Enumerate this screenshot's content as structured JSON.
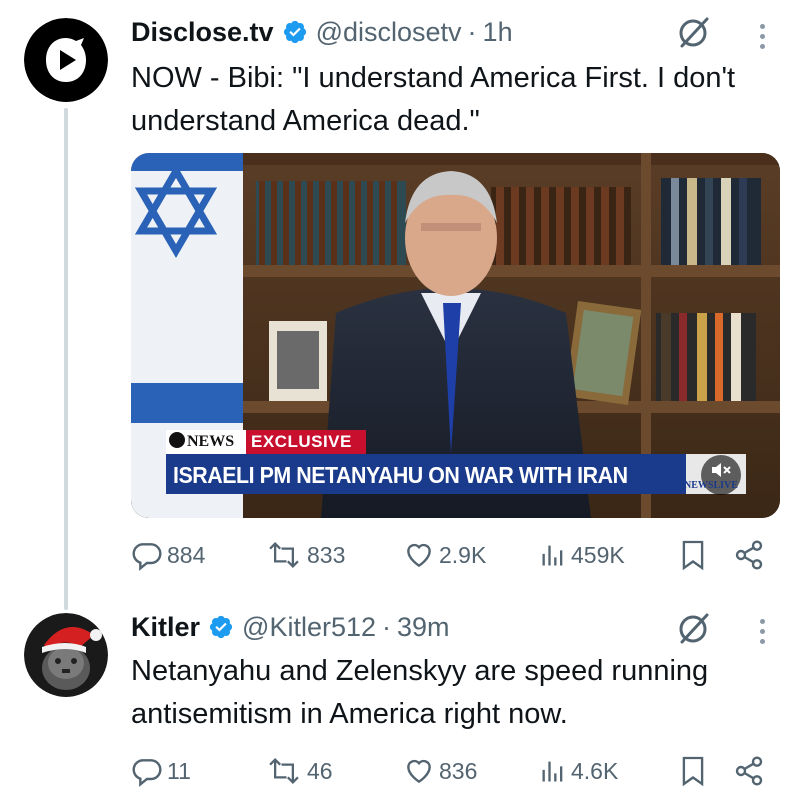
{
  "tweets": [
    {
      "author_name": "Disclose.tv",
      "handle": "@disclosetv",
      "separator": "·",
      "time": "1h",
      "text": "NOW - Bibi: \"I understand America First. I don't understand America dead.\"",
      "media": {
        "lower_third_brand": "NEWS",
        "lower_third_tag": "EXCLUSIVE",
        "headline": "ISRAELI PM NETANYAHU ON WAR WITH IRAN",
        "live_badge": "NEWSLIVE",
        "icon": "mute-icon"
      },
      "stats": {
        "replies": "884",
        "reposts": "833",
        "likes": "2.9K",
        "views": "459K"
      }
    },
    {
      "author_name": "Kitler",
      "handle": "@Kitler512",
      "separator": "·",
      "time": "39m",
      "text": "Netanyahu and Zelenskyy are speed running antisemitism in America right now.",
      "stats": {
        "replies": "11",
        "reposts": "46",
        "likes": "836",
        "views": "4.6K"
      }
    }
  ],
  "colors": {
    "verified": "#1d9bf0",
    "muted_text": "#536471",
    "icon_gray": "#536471",
    "news_red": "#c8102e",
    "news_blue": "#1a3a8c"
  },
  "icons": [
    "reply-icon",
    "repost-icon",
    "like-icon",
    "views-icon",
    "bookmark-icon",
    "share-icon",
    "grok-icon",
    "more-icon",
    "verified-icon"
  ]
}
